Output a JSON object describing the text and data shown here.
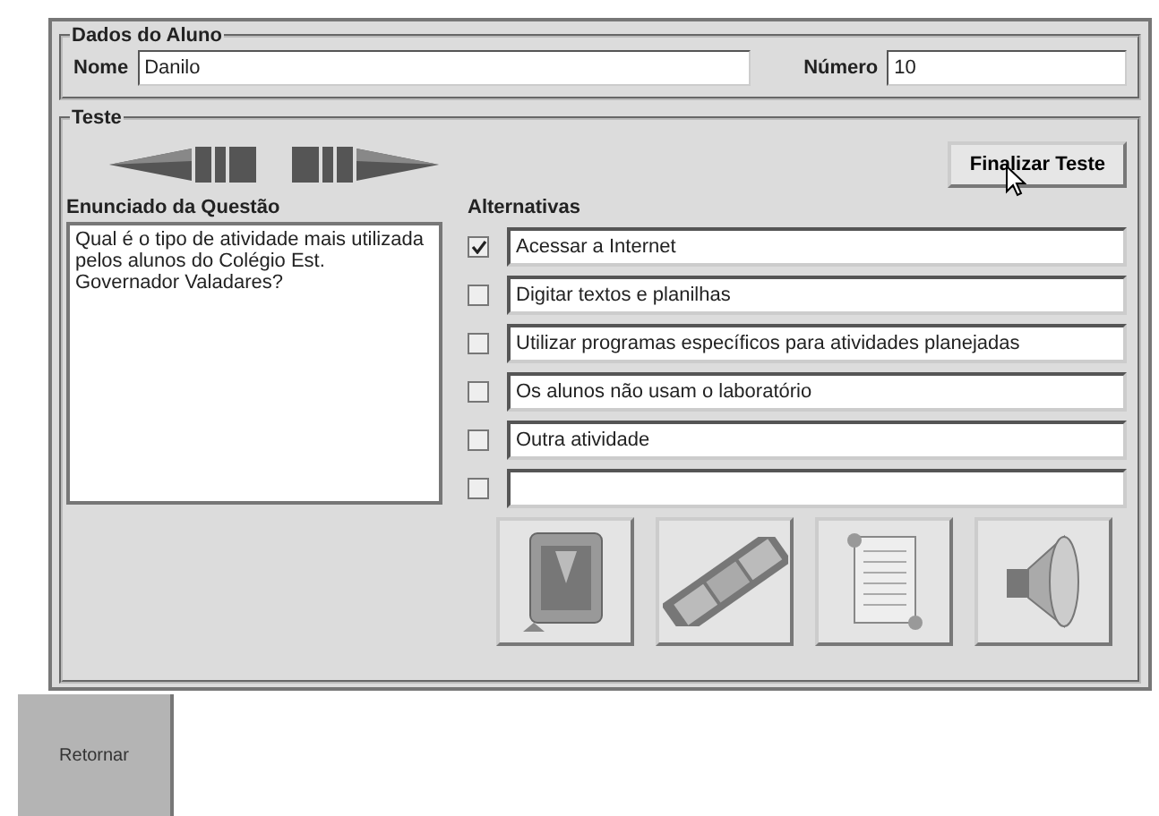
{
  "student_group": {
    "title": "Dados do Aluno",
    "name_label": "Nome",
    "name_value": "Danilo",
    "number_label": "Número",
    "number_value": "10"
  },
  "test_group": {
    "title": "Teste",
    "finish_button": "Finalizar Teste",
    "question_label": "Enunciado da Questão",
    "question_text": "Qual é o tipo de atividade mais utilizada pelos alunos do Colégio Est. Governador Valadares?",
    "alternatives_label": "Alternativas",
    "alternatives": [
      {
        "text": "Acessar a Internet",
        "checked": true
      },
      {
        "text": "Digitar textos e planilhas",
        "checked": false
      },
      {
        "text": "Utilizar programas específicos para atividades planejadas",
        "checked": false
      },
      {
        "text": "Os alunos não usam o laboratório",
        "checked": false
      },
      {
        "text": "Outra atividade",
        "checked": false
      },
      {
        "checked": false
      }
    ],
    "media_buttons": [
      {
        "kind": "image"
      },
      {
        "kind": "video"
      },
      {
        "kind": "text"
      },
      {
        "kind": "audio"
      }
    ]
  },
  "return_button": "Retornar"
}
